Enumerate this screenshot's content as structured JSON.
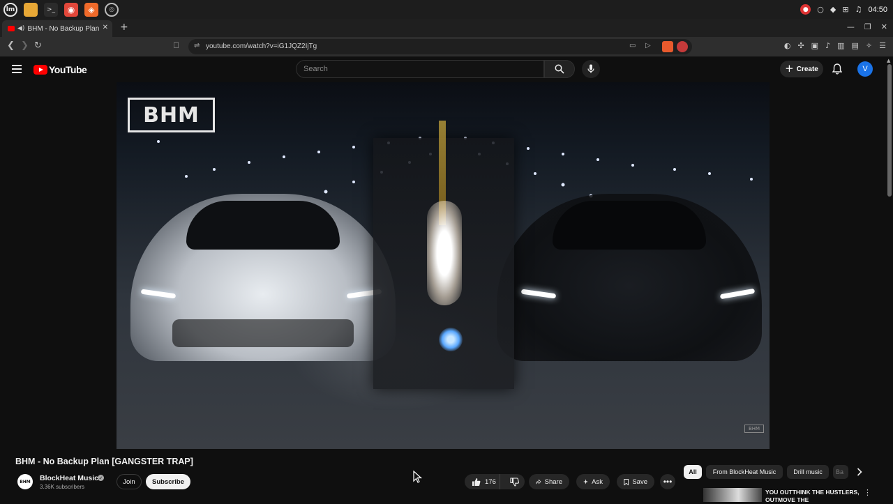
{
  "taskbar": {
    "apps": [
      "menu",
      "files",
      "terminal",
      "firefox",
      "brave",
      "chrome"
    ],
    "clock": "04:50"
  },
  "browser": {
    "tab_title": "BHM - No Backup Plan [GA",
    "url": "youtube.com/watch?v=iG1JQZ2IjTg"
  },
  "youtube": {
    "logo_text": "YouTube",
    "search_placeholder": "Search",
    "create_label": "Create",
    "avatar_initial": "V"
  },
  "video": {
    "overlay_logo": "BHM",
    "watermark": "BHM",
    "title": "BHM - No Backup Plan [GANGSTER TRAP]"
  },
  "channel": {
    "name": "BlockHeat Music",
    "subscribers": "3.36K subscribers",
    "avatar_text": "BHM",
    "join_label": "Join",
    "subscribe_label": "Subscribe"
  },
  "actions": {
    "likes": "176",
    "share_label": "Share",
    "ask_label": "Ask",
    "save_label": "Save"
  },
  "chips": {
    "all": "All",
    "from_channel": "From BlockHeat Music",
    "drill": "Drill music",
    "partial": "Ba"
  },
  "recommendation": {
    "title": "YOU OUTTHINK THE HUSTLERS, OUTMOVE THE"
  },
  "colors": {
    "background": "#0f0f0f",
    "youtube_red": "#ff0000",
    "chip_bg": "#272727",
    "avatar_blue": "#1a73e8"
  }
}
